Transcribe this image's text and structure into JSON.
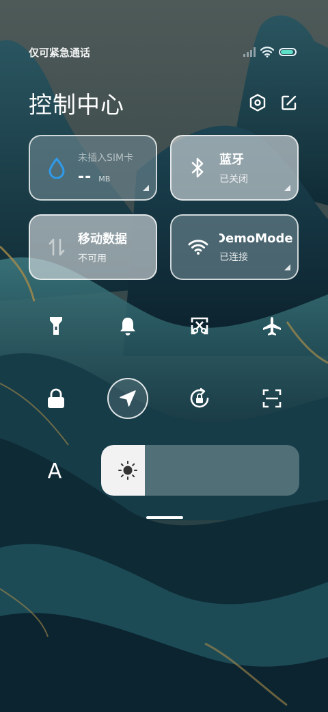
{
  "status_bar": {
    "carrier": "仅可紧急通话",
    "battery_level": 0.9
  },
  "header": {
    "title": "控制中心",
    "icons": [
      "settings-hexagon-icon",
      "edit-icon"
    ]
  },
  "tiles": {
    "sim": {
      "title": "未插入SIM卡",
      "value": "--",
      "unit": "MB",
      "icon": "water-drop-icon"
    },
    "bluetooth": {
      "title": "蓝牙",
      "status": "已关闭",
      "icon": "bluetooth-icon"
    },
    "mobile_data": {
      "title": "移动数据",
      "status": "不可用",
      "icon": "data-arrows-icon"
    },
    "wifi": {
      "title": "DemoMode",
      "status": "已连接",
      "icon": "wifi-icon"
    }
  },
  "toggles_row1": [
    "flashlight-icon",
    "bell-icon",
    "screenshot-icon",
    "airplane-icon"
  ],
  "toggles_row2": [
    "lock-icon",
    "location-icon",
    "rotation-lock-icon",
    "scan-icon"
  ],
  "font_button": "A",
  "brightness": {
    "level": 0.22,
    "icon": "sun-icon"
  },
  "colors": {
    "accent_blue": "#2f9bea",
    "tile_light": "#dce1e4",
    "tile_dark": "#6e8791"
  }
}
